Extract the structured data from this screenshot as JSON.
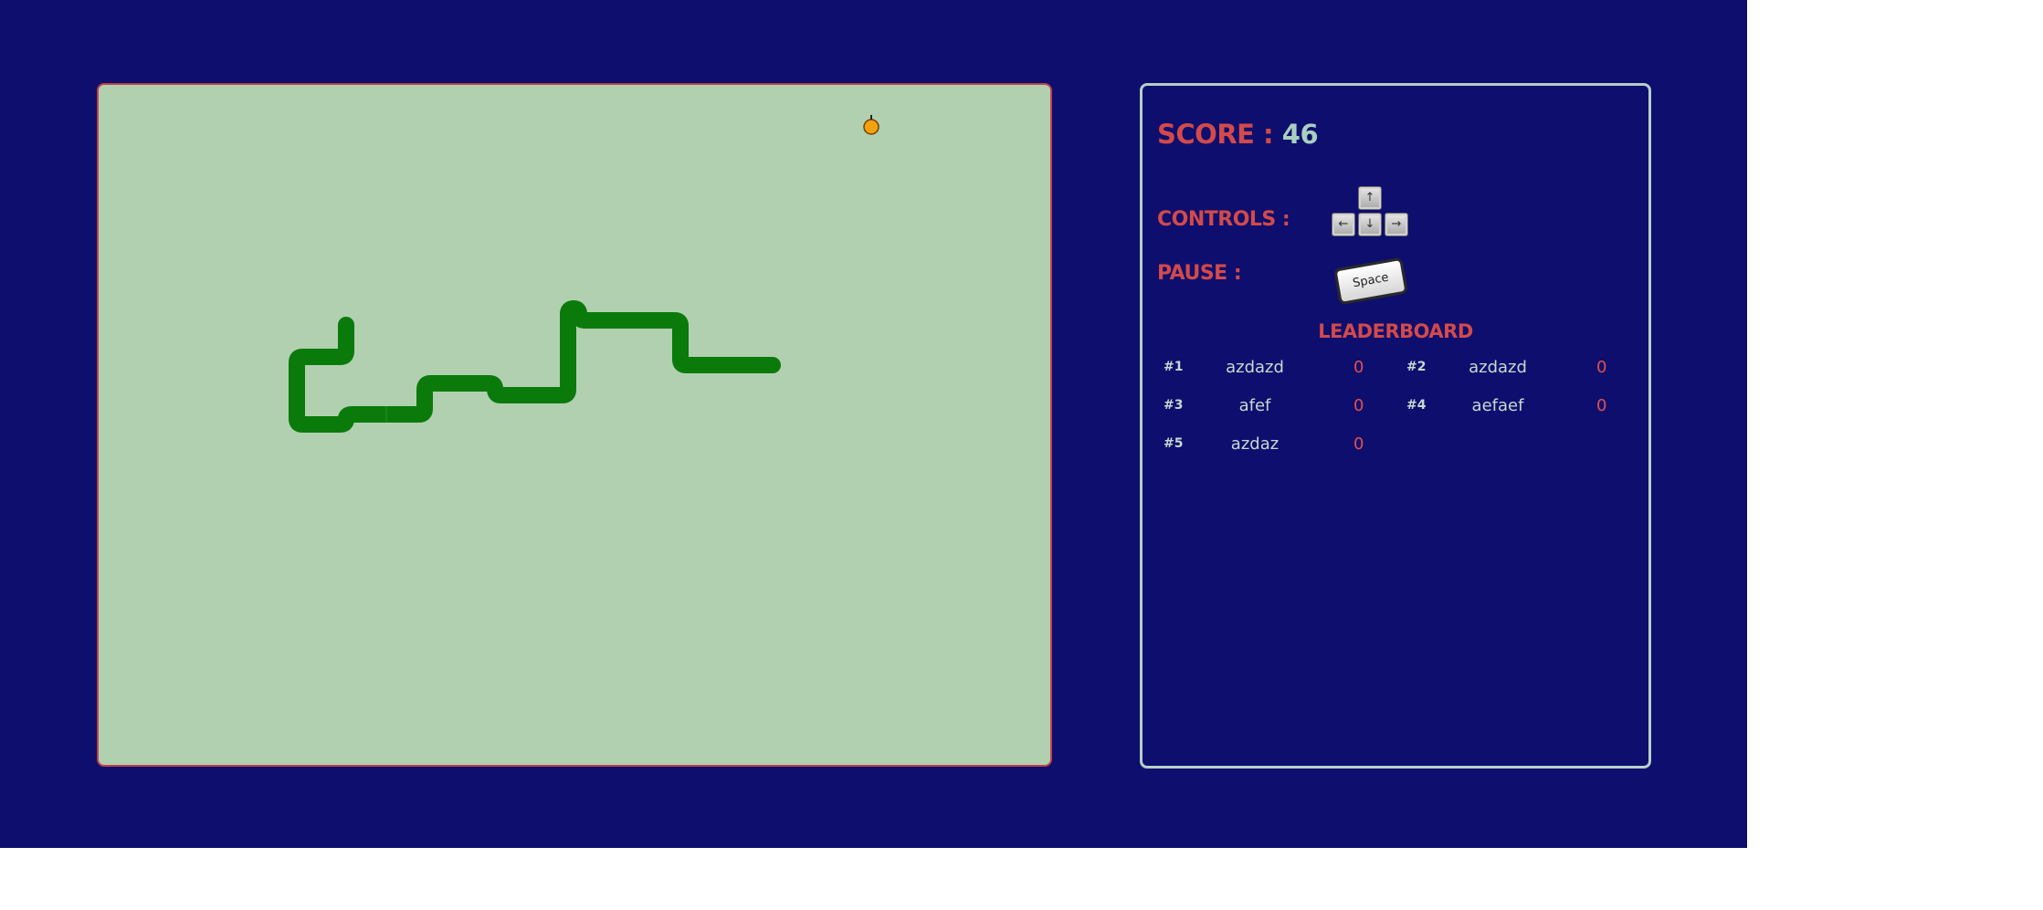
{
  "game": {
    "snake_color": "#0a7a0a",
    "board_color": "#b1d0b0",
    "fruit_icon": "orange-fruit-icon"
  },
  "panel": {
    "score_label": "SCORE : ",
    "score_value": "46",
    "controls_label": "CONTROLS :",
    "pause_label": "PAUSE :",
    "keys": {
      "up": "↑",
      "left": "←",
      "down": "↓",
      "right": "→",
      "space": "Space"
    },
    "leaderboard_title": "LEADERBOARD",
    "leaderboard": [
      {
        "rank": "#1",
        "name": "azdazd",
        "score": "0"
      },
      {
        "rank": "#2",
        "name": "azdazd",
        "score": "0"
      },
      {
        "rank": "#3",
        "name": "afef",
        "score": "0"
      },
      {
        "rank": "#4",
        "name": "aefaef",
        "score": "0"
      },
      {
        "rank": "#5",
        "name": "azdaz",
        "score": "0"
      }
    ]
  },
  "colors": {
    "background": "#0e0e6e",
    "accent": "#d24a4a",
    "score_value": "#a9cfc0",
    "panel_border": "#b6cfc8",
    "board_border": "#c0404a"
  }
}
